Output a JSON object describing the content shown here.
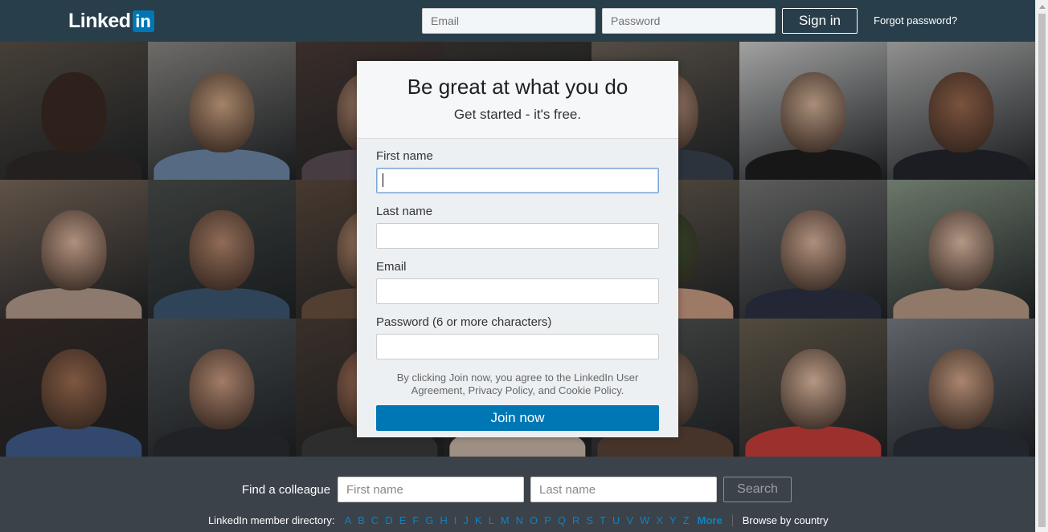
{
  "header": {
    "logo_text": "Linked",
    "logo_badge": "in",
    "email_placeholder": "Email",
    "password_placeholder": "Password",
    "signin_label": "Sign in",
    "forgot_label": "Forgot password?"
  },
  "signup": {
    "title": "Be great at what you do",
    "subtitle": "Get started - it's free.",
    "fields": [
      {
        "label": "First name",
        "value": ""
      },
      {
        "label": "Last name",
        "value": ""
      },
      {
        "label": "Email",
        "value": ""
      },
      {
        "label": "Password (6 or more characters)",
        "value": ""
      }
    ],
    "legal": "By clicking Join now, you agree to the LinkedIn User Agreement, Privacy Policy, and Cookie Policy.",
    "join_label": "Join now"
  },
  "footer": {
    "find_label": "Find a colleague",
    "first_placeholder": "First name",
    "last_placeholder": "Last name",
    "search_label": "Search",
    "directory_label": "LinkedIn member directory:",
    "letters": [
      "A",
      "B",
      "C",
      "D",
      "E",
      "F",
      "G",
      "H",
      "I",
      "J",
      "K",
      "L",
      "M",
      "N",
      "O",
      "P",
      "Q",
      "R",
      "S",
      "T",
      "U",
      "V",
      "W",
      "X",
      "Y",
      "Z"
    ],
    "more_label": "More",
    "browse_label": "Browse by country"
  },
  "colors": {
    "nav_bg": "#283e4a",
    "brand_blue": "#0077b5",
    "footer_bg": "#3b4249",
    "link_blue": "#0a84c7"
  }
}
